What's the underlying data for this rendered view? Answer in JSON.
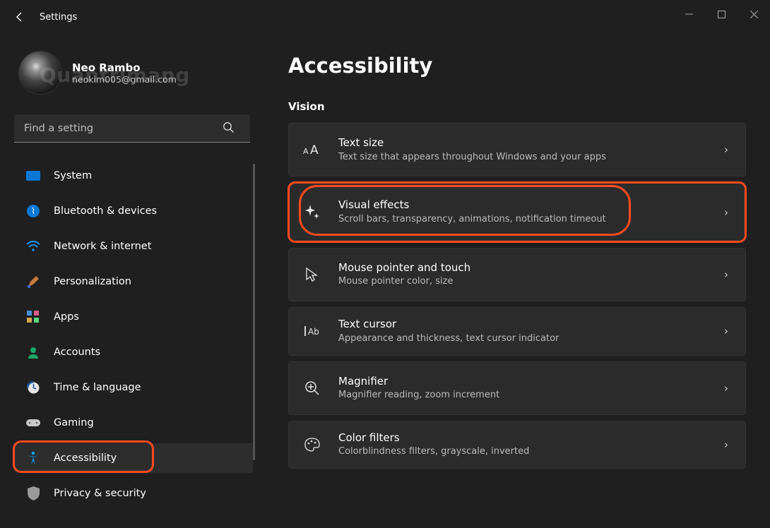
{
  "window": {
    "title": "Settings"
  },
  "profile": {
    "name": "Neo Rambo",
    "email": "neokim005@gmail.com",
    "watermark": "Quantrimang"
  },
  "search": {
    "placeholder": "Find a setting"
  },
  "sidebar": {
    "items": [
      {
        "label": "System"
      },
      {
        "label": "Bluetooth & devices"
      },
      {
        "label": "Network & internet"
      },
      {
        "label": "Personalization"
      },
      {
        "label": "Apps"
      },
      {
        "label": "Accounts"
      },
      {
        "label": "Time & language"
      },
      {
        "label": "Gaming"
      },
      {
        "label": "Accessibility"
      },
      {
        "label": "Privacy & security"
      }
    ]
  },
  "page": {
    "title": "Accessibility",
    "section": "Vision",
    "cards": [
      {
        "title": "Text size",
        "sub": "Text size that appears throughout Windows and your apps"
      },
      {
        "title": "Visual effects",
        "sub": "Scroll bars, transparency, animations, notification timeout"
      },
      {
        "title": "Mouse pointer and touch",
        "sub": "Mouse pointer color, size"
      },
      {
        "title": "Text cursor",
        "sub": "Appearance and thickness, text cursor indicator"
      },
      {
        "title": "Magnifier",
        "sub": "Magnifier reading, zoom increment"
      },
      {
        "title": "Color filters",
        "sub": "Colorblindness filters, grayscale, inverted"
      }
    ]
  }
}
